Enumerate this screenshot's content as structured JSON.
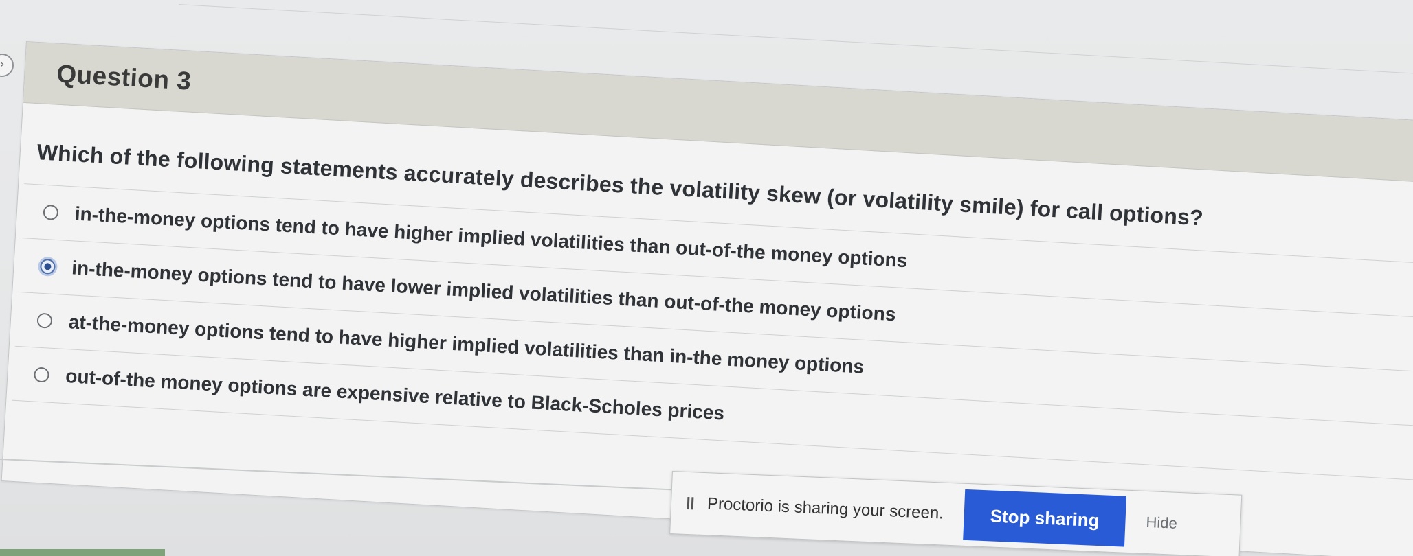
{
  "question": {
    "title": "Question 3",
    "text": "Which of the following statements accurately describes the volatility skew (or volatility smile) for call options?",
    "options": [
      {
        "label": "in-the-money options tend to have higher implied volatilities than out-of-the money options",
        "selected": false
      },
      {
        "label": "in-the-money options tend to have lower implied volatilities than out-of-the money options",
        "selected": true
      },
      {
        "label": "at-the-money options tend to have higher implied volatilities than in-the money options",
        "selected": false
      },
      {
        "label": "out-of-the money options are expensive relative to Black-Scholes prices",
        "selected": false
      }
    ]
  },
  "proctorio": {
    "message": "Proctorio is sharing your screen.",
    "stop_label": "Stop sharing",
    "hide_label": "Hide",
    "stop_color": "#2a5bd7"
  },
  "icons": {
    "toggle": "chevron-right-icon",
    "pause": "pause-icon"
  }
}
